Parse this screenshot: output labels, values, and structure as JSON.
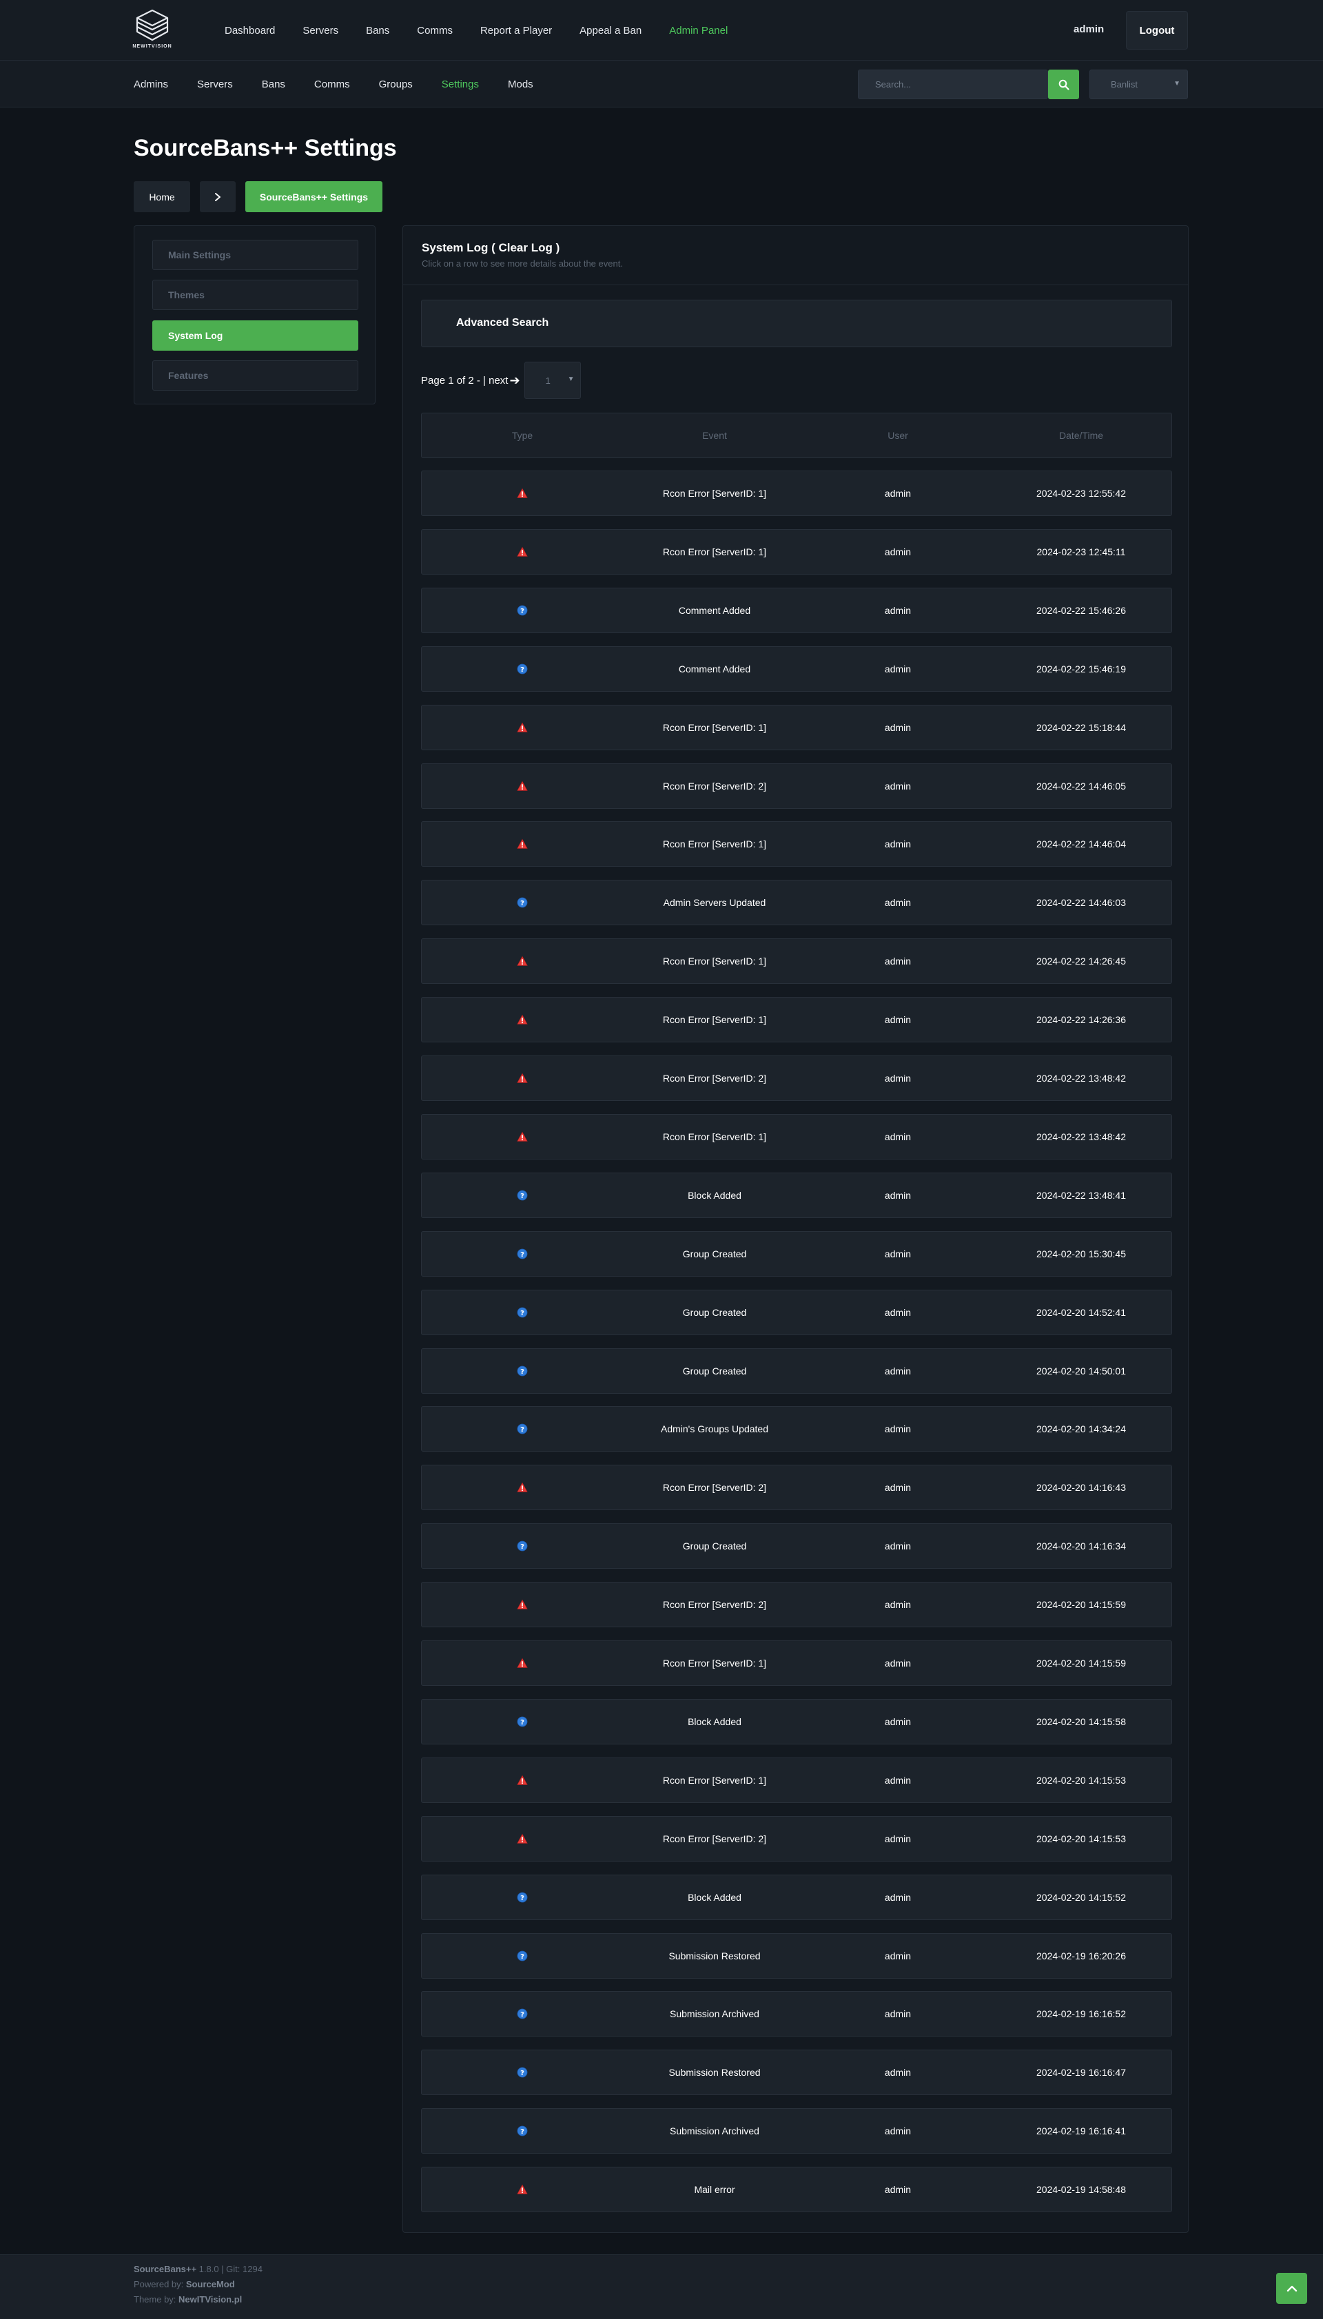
{
  "brand": {
    "logo_text": "NEWITVISION"
  },
  "main_nav": [
    {
      "label": "Dashboard",
      "active": false
    },
    {
      "label": "Servers",
      "active": false
    },
    {
      "label": "Bans",
      "active": false
    },
    {
      "label": "Comms",
      "active": false
    },
    {
      "label": "Report a Player",
      "active": false
    },
    {
      "label": "Appeal a Ban",
      "active": false
    },
    {
      "label": "Admin Panel",
      "active": true
    }
  ],
  "user": {
    "name": "admin",
    "logout_label": "Logout"
  },
  "sub_nav": [
    {
      "label": "Admins",
      "active": false
    },
    {
      "label": "Servers",
      "active": false
    },
    {
      "label": "Bans",
      "active": false
    },
    {
      "label": "Comms",
      "active": false
    },
    {
      "label": "Groups",
      "active": false
    },
    {
      "label": "Settings",
      "active": true
    },
    {
      "label": "Mods",
      "active": false
    }
  ],
  "search": {
    "placeholder": "Search...",
    "select_value": "Banlist"
  },
  "page": {
    "title": "SourceBans++ Settings",
    "breadcrumb": {
      "home": "Home",
      "current": "SourceBans++ Settings"
    }
  },
  "settings_menu": [
    {
      "label": "Main Settings",
      "active": false
    },
    {
      "label": "Themes",
      "active": false
    },
    {
      "label": "System Log",
      "active": true
    },
    {
      "label": "Features",
      "active": false
    }
  ],
  "system_log": {
    "title": "System Log ( Clear Log )",
    "subtitle": "Click on a row to see more details about the event.",
    "advanced_search": "Advanced Search",
    "pagination": {
      "text": "Page 1 of 2 - | next",
      "page_select": "1"
    },
    "columns": [
      "Type",
      "Event",
      "User",
      "Date/Time"
    ],
    "rows": [
      {
        "type": "warning",
        "event": "Rcon Error [ServerID: 1]",
        "user": "admin",
        "date": "2024-02-23 12:55:42"
      },
      {
        "type": "warning",
        "event": "Rcon Error [ServerID: 1]",
        "user": "admin",
        "date": "2024-02-23 12:45:11"
      },
      {
        "type": "info",
        "event": "Comment Added",
        "user": "admin",
        "date": "2024-02-22 15:46:26"
      },
      {
        "type": "info",
        "event": "Comment Added",
        "user": "admin",
        "date": "2024-02-22 15:46:19"
      },
      {
        "type": "warning",
        "event": "Rcon Error [ServerID: 1]",
        "user": "admin",
        "date": "2024-02-22 15:18:44"
      },
      {
        "type": "warning",
        "event": "Rcon Error [ServerID: 2]",
        "user": "admin",
        "date": "2024-02-22 14:46:05"
      },
      {
        "type": "warning",
        "event": "Rcon Error [ServerID: 1]",
        "user": "admin",
        "date": "2024-02-22 14:46:04"
      },
      {
        "type": "info",
        "event": "Admin Servers Updated",
        "user": "admin",
        "date": "2024-02-22 14:46:03"
      },
      {
        "type": "warning",
        "event": "Rcon Error [ServerID: 1]",
        "user": "admin",
        "date": "2024-02-22 14:26:45"
      },
      {
        "type": "warning",
        "event": "Rcon Error [ServerID: 1]",
        "user": "admin",
        "date": "2024-02-22 14:26:36"
      },
      {
        "type": "warning",
        "event": "Rcon Error [ServerID: 2]",
        "user": "admin",
        "date": "2024-02-22 13:48:42"
      },
      {
        "type": "warning",
        "event": "Rcon Error [ServerID: 1]",
        "user": "admin",
        "date": "2024-02-22 13:48:42"
      },
      {
        "type": "info",
        "event": "Block Added",
        "user": "admin",
        "date": "2024-02-22 13:48:41"
      },
      {
        "type": "info",
        "event": "Group Created",
        "user": "admin",
        "date": "2024-02-20 15:30:45"
      },
      {
        "type": "info",
        "event": "Group Created",
        "user": "admin",
        "date": "2024-02-20 14:52:41"
      },
      {
        "type": "info",
        "event": "Group Created",
        "user": "admin",
        "date": "2024-02-20 14:50:01"
      },
      {
        "type": "info",
        "event": "Admin's Groups Updated",
        "user": "admin",
        "date": "2024-02-20 14:34:24"
      },
      {
        "type": "warning",
        "event": "Rcon Error [ServerID: 2]",
        "user": "admin",
        "date": "2024-02-20 14:16:43"
      },
      {
        "type": "info",
        "event": "Group Created",
        "user": "admin",
        "date": "2024-02-20 14:16:34"
      },
      {
        "type": "warning",
        "event": "Rcon Error [ServerID: 2]",
        "user": "admin",
        "date": "2024-02-20 14:15:59"
      },
      {
        "type": "warning",
        "event": "Rcon Error [ServerID: 1]",
        "user": "admin",
        "date": "2024-02-20 14:15:59"
      },
      {
        "type": "info",
        "event": "Block Added",
        "user": "admin",
        "date": "2024-02-20 14:15:58"
      },
      {
        "type": "warning",
        "event": "Rcon Error [ServerID: 1]",
        "user": "admin",
        "date": "2024-02-20 14:15:53"
      },
      {
        "type": "warning",
        "event": "Rcon Error [ServerID: 2]",
        "user": "admin",
        "date": "2024-02-20 14:15:53"
      },
      {
        "type": "info",
        "event": "Block Added",
        "user": "admin",
        "date": "2024-02-20 14:15:52"
      },
      {
        "type": "info",
        "event": "Submission Restored",
        "user": "admin",
        "date": "2024-02-19 16:20:26"
      },
      {
        "type": "info",
        "event": "Submission Archived",
        "user": "admin",
        "date": "2024-02-19 16:16:52"
      },
      {
        "type": "info",
        "event": "Submission Restored",
        "user": "admin",
        "date": "2024-02-19 16:16:47"
      },
      {
        "type": "info",
        "event": "Submission Archived",
        "user": "admin",
        "date": "2024-02-19 16:16:41"
      },
      {
        "type": "warning",
        "event": "Mail error",
        "user": "admin",
        "date": "2024-02-19 14:58:48"
      }
    ]
  },
  "footer": {
    "version_name": "SourceBans++",
    "version_rest": "1.8.0 | Git: 1294",
    "powered_prefix": "Powered by:",
    "powered_name": "SourceMod",
    "theme_prefix": "Theme by:",
    "theme_name": "NewITVision.pl"
  },
  "colors": {
    "accent": "#4caf50",
    "accent_text": "#4ec95d",
    "background": "#0f141a"
  },
  "icons": {
    "warning": "warning-icon",
    "info": "info-icon"
  }
}
